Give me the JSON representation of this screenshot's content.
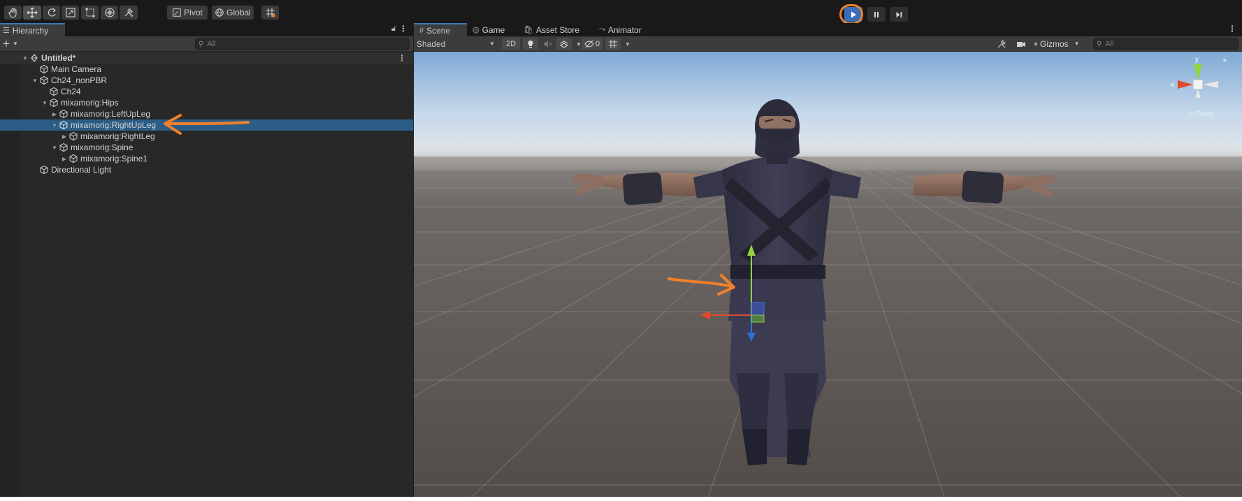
{
  "toolbar": {
    "tools": [
      {
        "name": "hand-tool",
        "icon": "hand-icon"
      },
      {
        "name": "move-tool",
        "icon": "move-icon",
        "selected": true
      },
      {
        "name": "rotate-tool",
        "icon": "rotate-icon"
      },
      {
        "name": "scale-tool",
        "icon": "scale-icon"
      },
      {
        "name": "rect-tool",
        "icon": "rect-icon"
      },
      {
        "name": "transform-tool",
        "icon": "transform-icon"
      },
      {
        "name": "custom-tool",
        "icon": "tools-icon"
      }
    ],
    "pivot_label": "Pivot",
    "global_label": "Global",
    "play_state": "playing"
  },
  "hierarchy": {
    "tab_label": "Hierarchy",
    "search_placeholder": "All",
    "scene_name": "Untitled*",
    "items": [
      {
        "label": "Main Camera"
      },
      {
        "label": "Ch24_nonPBR"
      },
      {
        "label": "Ch24"
      },
      {
        "label": "mixamorig:Hips"
      },
      {
        "label": "mixamorig:LeftUpLeg"
      },
      {
        "label": "mixamorig:RightUpLeg",
        "selected": true
      },
      {
        "label": "mixamorig:RightLeg"
      },
      {
        "label": "mixamorig:Spine"
      },
      {
        "label": "mixamorig:Spine1"
      },
      {
        "label": "Directional Light"
      }
    ]
  },
  "scene_panel": {
    "tabs": [
      {
        "label": "Scene",
        "icon": "grid-icon",
        "active": true
      },
      {
        "label": "Game",
        "icon": "gamepad-icon"
      },
      {
        "label": "Asset Store",
        "icon": "bag-icon"
      },
      {
        "label": "Animator",
        "icon": "animator-icon"
      }
    ],
    "shading_mode": "Shaded",
    "mode_2d": "2D",
    "hidden_count": "0",
    "gizmos_label": "Gizmos",
    "search_placeholder": "All",
    "orientation_gizmo": {
      "y_label": "y",
      "x_label": "x",
      "persp_label": "< Persp"
    }
  },
  "colors": {
    "accent": "#3a79bb",
    "selection": "#2c5d87",
    "annotation": "#f0802a",
    "panel": "#282828",
    "toolbar": "#3c3c3c"
  }
}
